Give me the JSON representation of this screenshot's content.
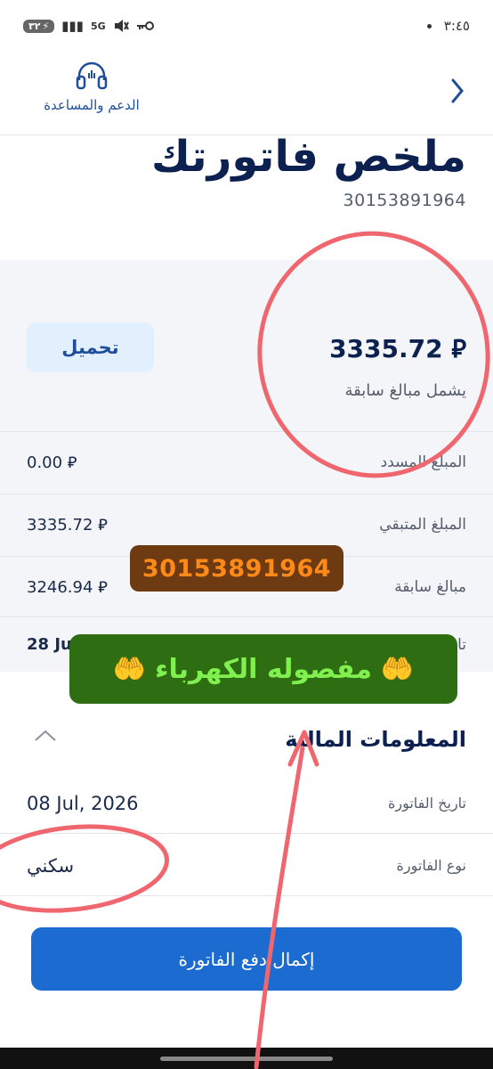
{
  "status_bar": {
    "time": "٣:٤٥",
    "battery": "٣٢",
    "network": "5G"
  },
  "header": {
    "support_label": "الدعم والمساعدة"
  },
  "page": {
    "title": "ملخص فاتورتك",
    "account_number": "30153891964"
  },
  "summary": {
    "total_amount": "3335.72 ⃁",
    "total_note": "يشمل مبالغ سابقة",
    "download_label": "تحميل",
    "rows": [
      {
        "label": "المبلغ المسدد",
        "value": "0.00 ⃁"
      },
      {
        "label": "المبلغ المتبقي",
        "value": "3335.72 ⃁"
      },
      {
        "label": "مبالغ سابقة",
        "value": "3246.94 ⃁"
      },
      {
        "label": "تا",
        "value": "28 Jul"
      }
    ]
  },
  "financial": {
    "title": "المعلومات المالية",
    "rows": [
      {
        "label": "تاريخ الفاتورة",
        "value": "08 Jul, 2026"
      },
      {
        "label": "نوع الفاتورة",
        "value": "سكني"
      }
    ]
  },
  "pay_button": {
    "label": "إكمال دفع الفاتورة"
  },
  "overlays": {
    "account_badge": "30153891964",
    "banner_text": "مفصوله الكهرباء",
    "banner_emoji": "🤲"
  },
  "colors": {
    "primary": "#1b6bd1",
    "title": "#0d2150",
    "annotation": "#f0666e"
  }
}
